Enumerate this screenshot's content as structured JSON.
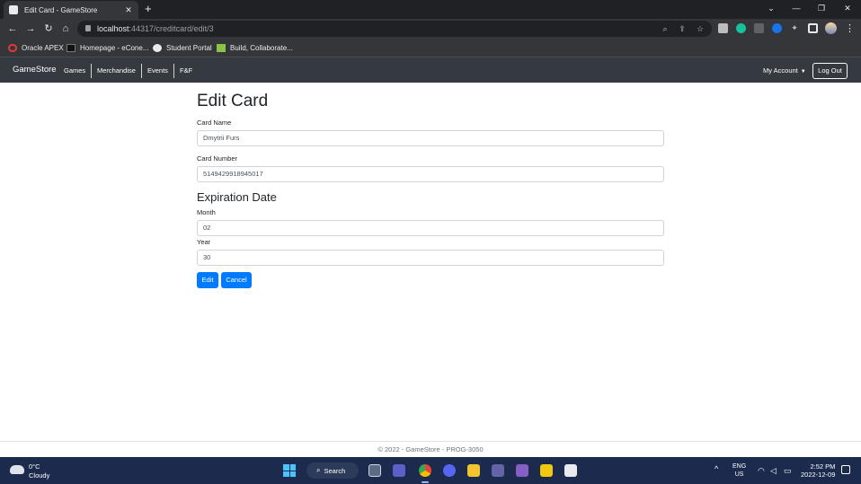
{
  "browser": {
    "tab_title": "Edit Card - GameStore",
    "tab_close": "✕",
    "new_tab": "+",
    "url_host": "localhost",
    "url_path": ":44317/creditcard/edit/3",
    "window_minimize": "—",
    "window_restore": "❐",
    "window_close": "✕",
    "tab_search": "⌄"
  },
  "bookmarks": [
    {
      "label": "Oracle APEX",
      "color": "#e53935"
    },
    {
      "label": "Homepage - eCone...",
      "color": "#111111"
    },
    {
      "label": "Student Portal",
      "color": "#e8eaed"
    },
    {
      "label": "Build, Collaborate...",
      "color": "#8bc34a"
    }
  ],
  "navbar": {
    "brand": "GameStore",
    "links": [
      "Games",
      "Merchandise",
      "Events",
      "F&F"
    ],
    "account": "My Account",
    "logout": "Log Out"
  },
  "form": {
    "title": "Edit Card",
    "card_name_label": "Card Name",
    "card_name_value": "Dmytrii Furs",
    "card_number_label": "Card Number",
    "card_number_value": "5149429918945017",
    "expiration_title": "Expiration Date",
    "month_label": "Month",
    "month_value": "02",
    "year_label": "Year",
    "year_value": "30",
    "edit_button": "Edit",
    "cancel_button": "Cancel"
  },
  "footer": {
    "text": "© 2022 - GameStore - PROG-3050"
  },
  "taskbar": {
    "weather_temp": "0°C",
    "weather_desc": "Cloudy",
    "search_label": "Search",
    "lang_top": "ENG",
    "lang_bottom": "US",
    "time": "2:52 PM",
    "date": "2022-12-09"
  },
  "colors": {
    "primary": "#007bff",
    "navbar_bg": "#343a40",
    "taskbar_bg": "#1c2b4d"
  }
}
